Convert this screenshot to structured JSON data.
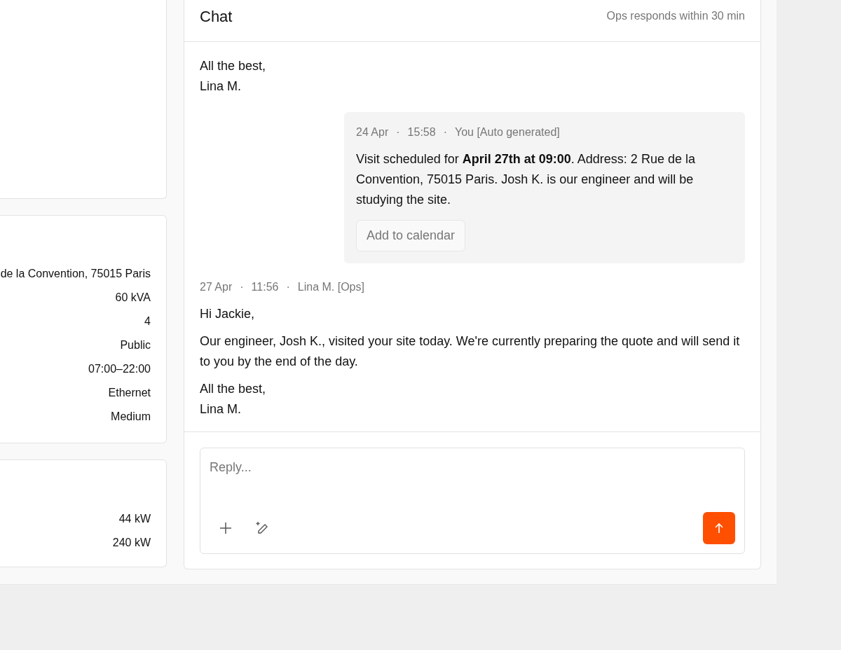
{
  "site_details": {
    "values": [
      "de la Convention, 75015 Paris",
      "60 kVA",
      "4",
      "Public",
      "07:00–22:00",
      "Ethernet",
      "Medium"
    ]
  },
  "power": {
    "values": [
      "44 kW",
      "240 kW"
    ]
  },
  "chat": {
    "title": "Chat",
    "response_note": "Ops responds within 30 min",
    "messages": [
      {
        "kind": "incoming",
        "paragraphs": [
          "All the best,\nLina M."
        ]
      },
      {
        "kind": "outgoing",
        "meta": [
          "24 Apr",
          "·",
          "15:58",
          "·",
          "You [Auto generated]"
        ],
        "paragraphs": [
          "Visit scheduled for **April 27th at 09:00**. Address: 2 Rue de la Convention, 75015 Paris. Josh K. is our engineer and will be studying the site."
        ],
        "action": "Add to calendar"
      },
      {
        "kind": "incoming",
        "meta": [
          "27 Apr",
          "·",
          "11:56",
          "·",
          "Lina M. [Ops]"
        ],
        "paragraphs": [
          "Hi Jackie,",
          "Our engineer, Josh K., visited your site today. We're currently preparing the quote and will send it to you by the end of the day.",
          "All the best,\nLina M."
        ]
      }
    ],
    "composer": {
      "placeholder": "Reply..."
    }
  }
}
